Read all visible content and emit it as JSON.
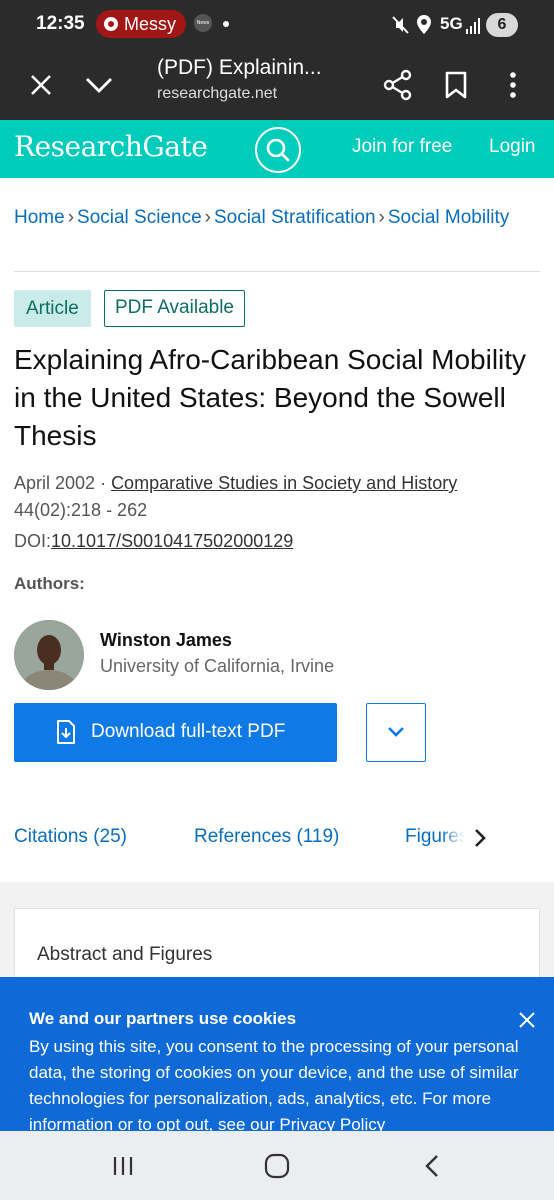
{
  "status_bar": {
    "time": "12:35",
    "media_pill": "Messy",
    "news_icon_text": "News",
    "network": "5G",
    "notification_count": "6"
  },
  "browser": {
    "page_title": "(PDF) Explainin...",
    "url": "researchgate.net"
  },
  "header": {
    "logo": "ResearchGate",
    "join_label": "Join for free",
    "login_label": "Login",
    "brand_color": "#00ccbb"
  },
  "breadcrumb": [
    "Home",
    "Social Science",
    "Social Stratification",
    "Social Mobility"
  ],
  "badges": {
    "type": "Article",
    "pdf": "PDF Available"
  },
  "article": {
    "title": "Explaining Afro-Caribbean Social Mobility in the United States: Beyond the Sowell Thesis",
    "date": "April 2002",
    "journal": "Comparative Studies in Society and History",
    "volume_pages": "44(02):218 - 262",
    "doi_prefix": "DOI:",
    "doi": "10.1017/S0010417502000129"
  },
  "authors": {
    "label": "Authors:",
    "list": [
      {
        "name": "Winston James",
        "institution": "University of California, Irvine"
      }
    ]
  },
  "actions": {
    "download_label": "Download full-text PDF",
    "accent_color": "#0f7ae5"
  },
  "tabs": [
    {
      "label": "Citations (25)"
    },
    {
      "label": "References (119)"
    },
    {
      "label": "Figures"
    }
  ],
  "abstract_card": {
    "title": "Abstract and Figures"
  },
  "cookie_banner": {
    "title": "We and our partners use cookies",
    "text": "By using this site, you consent to the processing of your personal data, the storing of cookies on your device, and the use of similar technologies for personalization, ads, analytics, etc. For more information or to opt out, see our ",
    "privacy_link": "Privacy Policy",
    "background": "#0f6ad8"
  },
  "icons": {
    "close_tab": "close-icon",
    "collapse": "chevron-down-icon",
    "share": "share-icon",
    "bookmark": "bookmark-icon",
    "menu": "more-vert-icon",
    "search": "search-icon"
  }
}
